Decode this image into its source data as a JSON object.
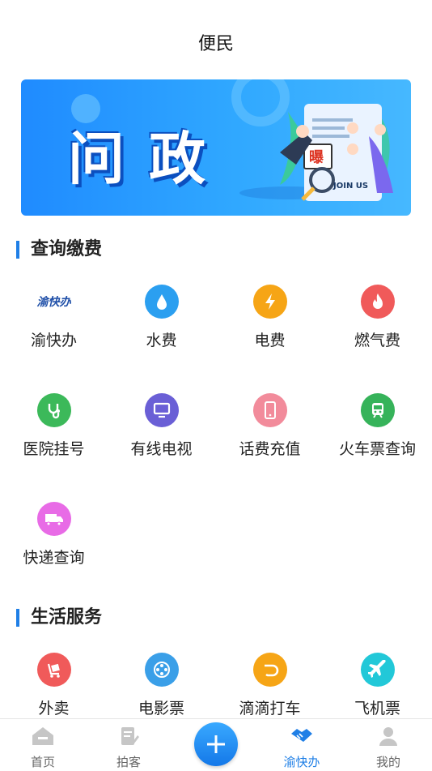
{
  "header": {
    "title": "便民"
  },
  "banner": {
    "title": "问政",
    "badge": "曝",
    "join": "JOIN US"
  },
  "sections": {
    "query": {
      "title": "查询缴费",
      "items": [
        {
          "label": "渝快办",
          "logo": "渝快办",
          "icon": "yukuaiban-logo"
        },
        {
          "label": "水费",
          "icon": "water-drop-icon",
          "color": "#2b9ff0"
        },
        {
          "label": "电费",
          "icon": "lightning-icon",
          "color": "#f6a516"
        },
        {
          "label": "燃气费",
          "icon": "flame-icon",
          "color": "#f05a5a"
        },
        {
          "label": "医院挂号",
          "icon": "stethoscope-icon",
          "color": "#3cb95a"
        },
        {
          "label": "有线电视",
          "icon": "tv-icon",
          "color": "#6a5fd6"
        },
        {
          "label": "话费充值",
          "icon": "phone-icon",
          "color": "#f28b9b"
        },
        {
          "label": "火车票查询",
          "icon": "train-icon",
          "color": "#36b35a"
        },
        {
          "label": "快递查询",
          "icon": "truck-icon",
          "color": "#e86be6"
        }
      ]
    },
    "life": {
      "title": "生活服务",
      "items": [
        {
          "label": "外卖",
          "icon": "delivery-icon",
          "color": "#f05a5a"
        },
        {
          "label": "电影票",
          "icon": "film-reel-icon",
          "color": "#3a9fe8"
        },
        {
          "label": "滴滴打车",
          "icon": "didi-icon",
          "color": "#f6a516"
        },
        {
          "label": "飞机票",
          "icon": "airplane-icon",
          "color": "#22c8d8"
        }
      ]
    }
  },
  "tabbar": {
    "tabs": [
      {
        "label": "首页",
        "icon": "home-icon"
      },
      {
        "label": "拍客",
        "icon": "document-edit-icon"
      },
      {
        "label": "渝快办",
        "icon": "handshake-icon",
        "active": true
      },
      {
        "label": "我的",
        "icon": "user-icon"
      }
    ],
    "fab_icon": "plus-icon",
    "active_color": "#1f7fe6"
  }
}
